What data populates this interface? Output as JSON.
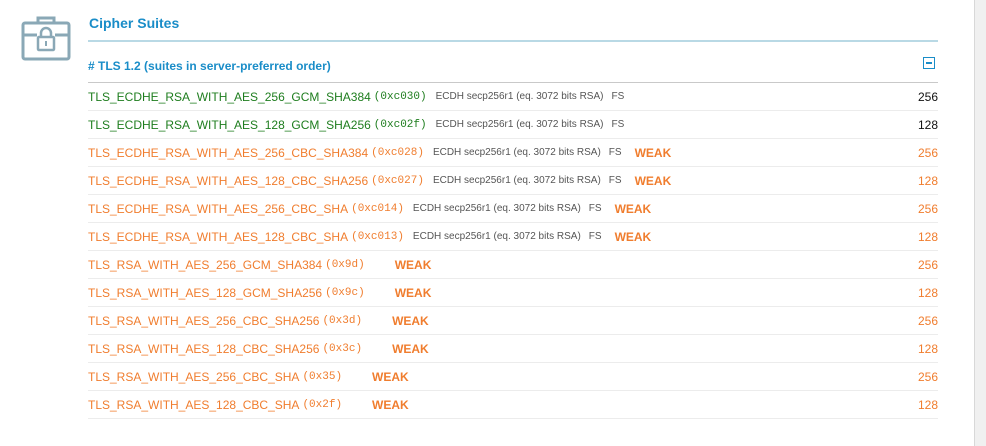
{
  "section": {
    "title": "Cipher Suites",
    "icon": "lock-box-icon"
  },
  "tls": {
    "header": "# TLS 1.2 (suites in server-preferred order)",
    "collapse_icon": "minus-square-icon"
  },
  "colors": {
    "accent": "#1a8dc8",
    "secure": "#1e7d1e",
    "weak": "#f07d2e"
  },
  "suites": [
    {
      "name": "TLS_ECDHE_RSA_WITH_AES_256_GCM_SHA384",
      "hex": "(0xc030)",
      "kx": "ECDH secp256r1 (eq. 3072 bits RSA)",
      "fs": "FS",
      "flag": "",
      "bits": "256",
      "status": "good"
    },
    {
      "name": "TLS_ECDHE_RSA_WITH_AES_128_GCM_SHA256",
      "hex": "(0xc02f)",
      "kx": "ECDH secp256r1 (eq. 3072 bits RSA)",
      "fs": "FS",
      "flag": "",
      "bits": "128",
      "status": "good"
    },
    {
      "name": "TLS_ECDHE_RSA_WITH_AES_256_CBC_SHA384",
      "hex": "(0xc028)",
      "kx": "ECDH secp256r1 (eq. 3072 bits RSA)",
      "fs": "FS",
      "flag": "WEAK",
      "bits": "256",
      "status": "warn"
    },
    {
      "name": "TLS_ECDHE_RSA_WITH_AES_128_CBC_SHA256",
      "hex": "(0xc027)",
      "kx": "ECDH secp256r1 (eq. 3072 bits RSA)",
      "fs": "FS",
      "flag": "WEAK",
      "bits": "128",
      "status": "warn"
    },
    {
      "name": "TLS_ECDHE_RSA_WITH_AES_256_CBC_SHA",
      "hex": "(0xc014)",
      "kx": "ECDH secp256r1 (eq. 3072 bits RSA)",
      "fs": "FS",
      "flag": "WEAK",
      "bits": "256",
      "status": "warn"
    },
    {
      "name": "TLS_ECDHE_RSA_WITH_AES_128_CBC_SHA",
      "hex": "(0xc013)",
      "kx": "ECDH secp256r1 (eq. 3072 bits RSA)",
      "fs": "FS",
      "flag": "WEAK",
      "bits": "128",
      "status": "warn"
    },
    {
      "name": "TLS_RSA_WITH_AES_256_GCM_SHA384",
      "hex": "(0x9d)",
      "kx": "",
      "fs": "",
      "flag": "WEAK",
      "bits": "256",
      "status": "warn"
    },
    {
      "name": "TLS_RSA_WITH_AES_128_GCM_SHA256",
      "hex": "(0x9c)",
      "kx": "",
      "fs": "",
      "flag": "WEAK",
      "bits": "128",
      "status": "warn"
    },
    {
      "name": "TLS_RSA_WITH_AES_256_CBC_SHA256",
      "hex": "(0x3d)",
      "kx": "",
      "fs": "",
      "flag": "WEAK",
      "bits": "256",
      "status": "warn"
    },
    {
      "name": "TLS_RSA_WITH_AES_128_CBC_SHA256",
      "hex": "(0x3c)",
      "kx": "",
      "fs": "",
      "flag": "WEAK",
      "bits": "128",
      "status": "warn"
    },
    {
      "name": "TLS_RSA_WITH_AES_256_CBC_SHA",
      "hex": "(0x35)",
      "kx": "",
      "fs": "",
      "flag": "WEAK",
      "bits": "256",
      "status": "warn"
    },
    {
      "name": "TLS_RSA_WITH_AES_128_CBC_SHA",
      "hex": "(0x2f)",
      "kx": "",
      "fs": "",
      "flag": "WEAK",
      "bits": "128",
      "status": "warn"
    }
  ]
}
